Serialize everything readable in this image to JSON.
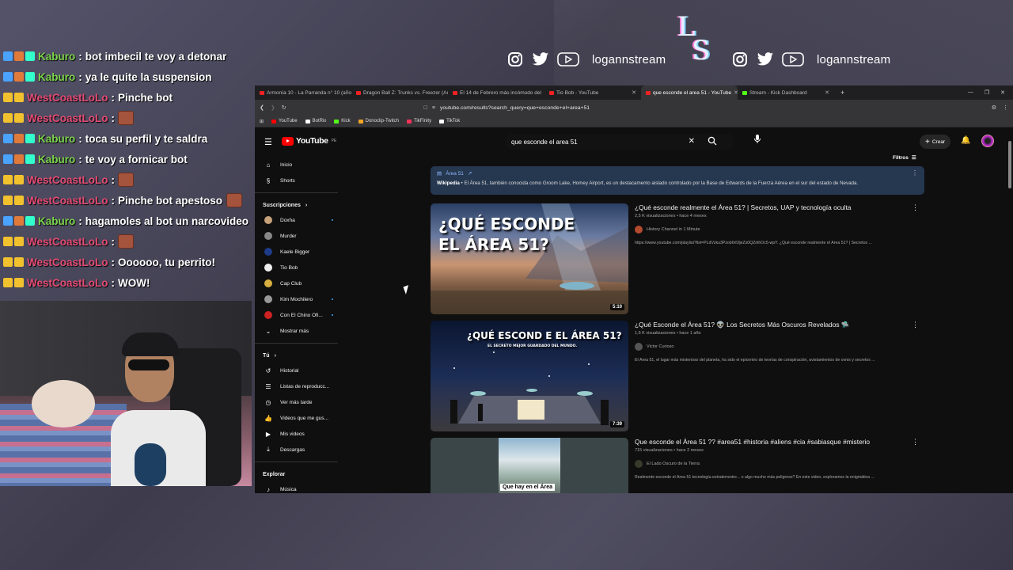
{
  "overlay": {
    "social_left": {
      "handle": "logannstream"
    },
    "social_right": {
      "handle": "logannstream"
    },
    "logo": {
      "l": "L",
      "s": "S"
    }
  },
  "chat": {
    "messages": [
      {
        "user": "Kaburo",
        "user_color": "#7bd44a",
        "text": "bot imbecil te voy a detonar"
      },
      {
        "user": "Kaburo",
        "user_color": "#7bd44a",
        "text": "ya le quite la suspension"
      },
      {
        "user": "WestCoastLoLo",
        "user_color": "#e54b74",
        "text": "Pinche bot"
      },
      {
        "user": "WestCoastLoLo",
        "user_color": "#e54b74",
        "text": ""
      },
      {
        "user": "Kaburo",
        "user_color": "#7bd44a",
        "text": "toca su perfil y te saldra"
      },
      {
        "user": "Kaburo",
        "user_color": "#7bd44a",
        "text": "te voy a fornicar bot"
      },
      {
        "user": "WestCoastLoLo",
        "user_color": "#e54b74",
        "text": ""
      },
      {
        "user": "WestCoastLoLo",
        "user_color": "#e54b74",
        "text": "Pinche bot apestoso"
      },
      {
        "user": "Kaburo",
        "user_color": "#7bd44a",
        "text": "hagamoles al bot un narcovideo"
      },
      {
        "user": "WestCoastLoLo",
        "user_color": "#e54b74",
        "text": ""
      },
      {
        "user": "WestCoastLoLo",
        "user_color": "#e54b74",
        "text": "Oooooo, tu perrito!"
      },
      {
        "user": "WestCoastLoLo",
        "user_color": "#e54b74",
        "text": "WOW!"
      }
    ]
  },
  "browser": {
    "tabs": [
      {
        "label": "Armonía 10 - La Parranda n° 10 (año",
        "icon": "youtube-icon",
        "active": false
      },
      {
        "label": "Dragon Ball Z: Trunks vs. Freezer (An",
        "icon": "youtube-icon",
        "active": false
      },
      {
        "label": "El 14 de Febrero más incómodo del",
        "icon": "youtube-icon",
        "active": false
      },
      {
        "label": "Tio Bob - YouTube",
        "icon": "youtube-icon",
        "active": false
      },
      {
        "label": "que esconde el area 51 - YouTube",
        "icon": "youtube-icon",
        "active": true
      },
      {
        "label": "Stream - Kick Dashboard",
        "icon": "kick-icon",
        "active": false
      }
    ],
    "url": "youtube.com/results?search_query=que+esconde+el+area+51",
    "bookmarks": [
      {
        "label": "YouTube",
        "color": "#ff0000"
      },
      {
        "label": "BotRix",
        "color": "#ffffff"
      },
      {
        "label": "Kick",
        "color": "#53fc18"
      },
      {
        "label": "Donoclip-Twitch",
        "color": "#f5a623"
      },
      {
        "label": "TikFinity",
        "color": "#ff3355"
      },
      {
        "label": "TikTok",
        "color": "#ffffff"
      }
    ]
  },
  "youtube": {
    "logo_word": "YouTube",
    "logo_region": "PE",
    "search_value": "que esconde el area 51",
    "create_label": "Crear",
    "filters_label": "Filtros",
    "sidebar": {
      "main": [
        {
          "label": "Inicio",
          "icon": "home-icon"
        },
        {
          "label": "Shorts",
          "icon": "shorts-icon"
        }
      ],
      "subs_header": "Suscripciones",
      "subs": [
        {
          "label": "Doxha",
          "color": "#c8a27a",
          "dot": true
        },
        {
          "label": "Murder",
          "color": "#888888",
          "dot": false
        },
        {
          "label": "Kaele Bigger",
          "color": "#1e3a8a",
          "dot": false
        },
        {
          "label": "Tio Bob",
          "color": "#eeeeee",
          "dot": false
        },
        {
          "label": "Cap Club",
          "color": "#d8b040",
          "dot": false
        },
        {
          "label": "Kim Mochilero",
          "color": "#999999",
          "dot": true
        },
        {
          "label": "Con El Chino Ofi...",
          "color": "#c22",
          "dot": true
        }
      ],
      "show_more": "Mostrar más",
      "you_header": "Tú",
      "you": [
        {
          "label": "Historial",
          "icon": "history-icon"
        },
        {
          "label": "Listas de reproducc...",
          "icon": "playlist-icon"
        },
        {
          "label": "Ver más tarde",
          "icon": "clock-icon"
        },
        {
          "label": "Videos que me gus...",
          "icon": "thumbs-up-icon"
        },
        {
          "label": "Mis videos",
          "icon": "video-icon"
        },
        {
          "label": "Descargas",
          "icon": "download-icon"
        }
      ],
      "explore_header": "Explorar",
      "explore": [
        {
          "label": "Música",
          "icon": "music-icon"
        }
      ]
    },
    "wiki": {
      "title": "Área 51",
      "source": "Wikipedia",
      "text": "El Área 51, también conocida como Groom Lake, Homey Airport, es un destacamento aislado controlado por la Base de Edwards de la Fuerza Aérea en el sur del estado de Nevada."
    },
    "videos": [
      {
        "title": "¿Qué esconde realmente el Área 51? | Secretos, UAP y tecnología oculta",
        "meta": "2,5 K visualizaciones • hace 4 meses",
        "channel": "History Channel in 1 Minute",
        "desc": "https://www.youtube.com/playlist?list=PLdVzku3Pzob6rfJljeZs0QZnlhOc5-wpY. ¿Qué esconde realmente el Área 51? | Secretos ...",
        "duration": "5:10",
        "thumb_text_1": "¿QUÉ ESCONDE",
        "thumb_text_2": "EL ÁREA 51?"
      },
      {
        "title": "¿Qué Esconde el Área 51? 👽 Los Secretos Más Oscuros Revelados 🛸",
        "meta": "1,6 K visualizaciones • hace 1 año",
        "channel": "Victor Curioso",
        "desc": "El Área 51, el lugar más misterioso del planeta, ha sido el epicentro de teorías de conspiración, avistamientos de ovnis y secretos ...",
        "duration": "7:39",
        "thumb_text_1": "¿QUÉ ESCOND E EL ÁREA 51?",
        "thumb_text_2": "EL SECRETO MEJOR GUARDADO DEL MUNDO."
      },
      {
        "title": "Que esconde el Área 51 ?? #area51 #historia #aliens #cia #sabiasque #misterio",
        "meta": "715 visualizaciones • hace 2 meses",
        "channel": "El Lado Oscuro de la Tierra",
        "desc": "Realmente esconde el Área 51 tecnología extraterrestre... o algo mucho más peligroso? En este video, exploramos la enigmática ...",
        "duration": "",
        "thumb_text_1": "Que hay en el Área",
        "thumb_text_2": ""
      }
    ]
  }
}
